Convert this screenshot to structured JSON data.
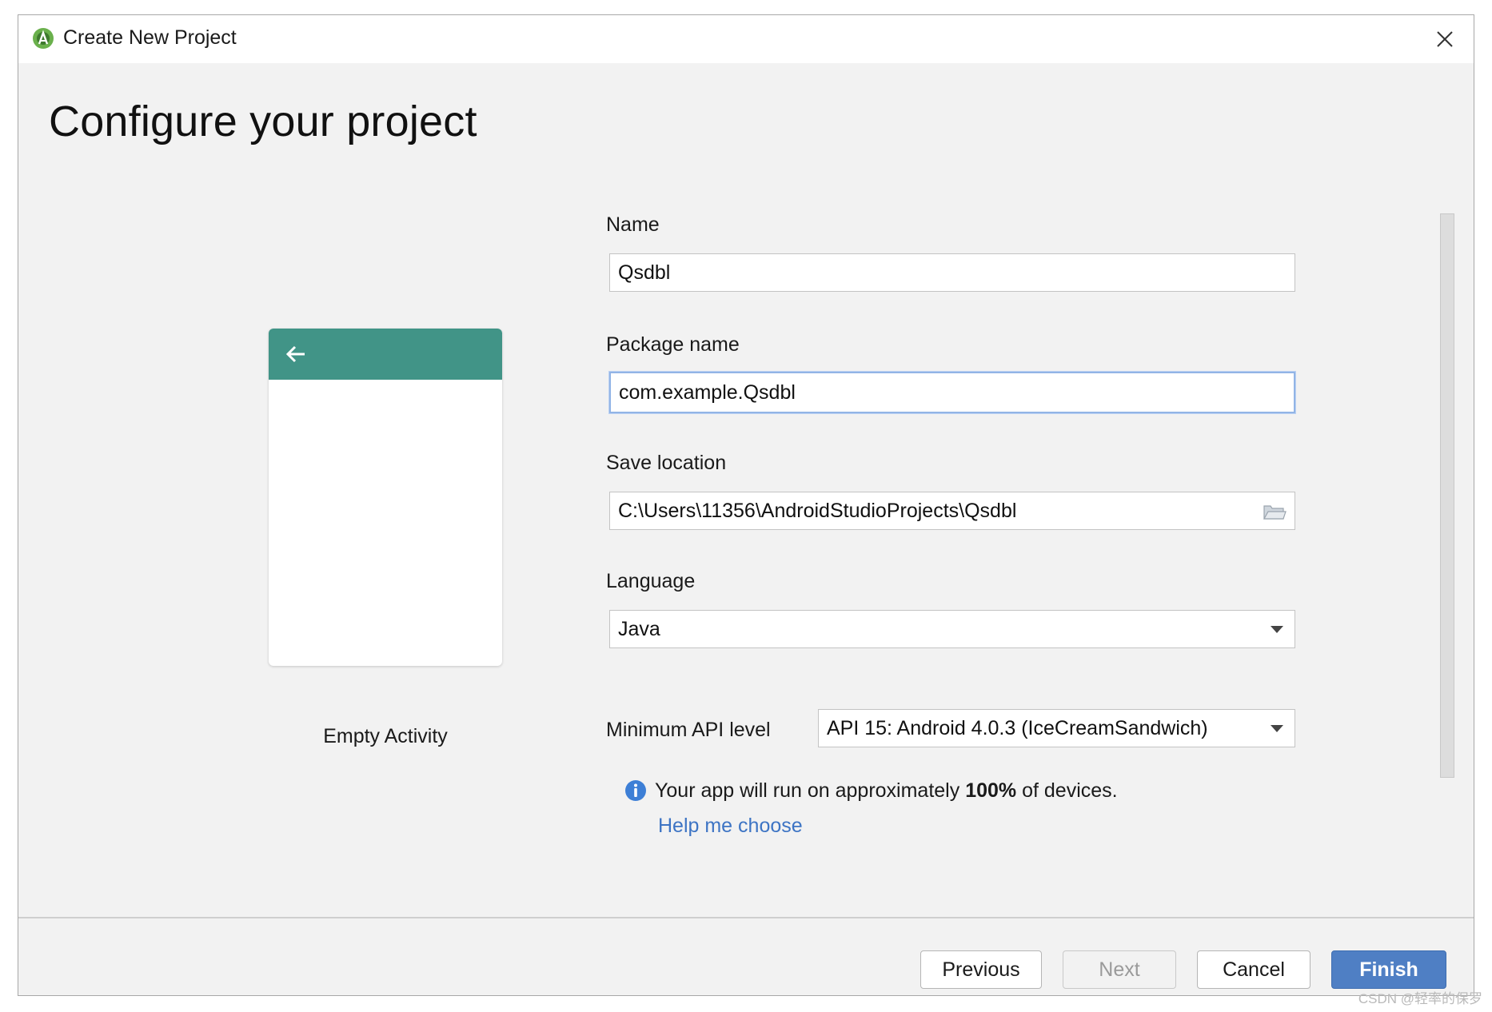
{
  "window": {
    "title": "Create New Project"
  },
  "page": {
    "heading": "Configure your project"
  },
  "preview": {
    "caption": "Empty Activity",
    "appbar_color": "#419487"
  },
  "form": {
    "name_label": "Name",
    "name_value": "Qsdbl",
    "package_label": "Package name",
    "package_value": "com.example.Qsdbl",
    "location_label": "Save location",
    "location_value": "C:\\Users\\11356\\AndroidStudioProjects\\Qsdbl",
    "language_label": "Language",
    "language_value": "Java",
    "api_label": "Minimum API level",
    "api_value": "API 15: Android 4.0.3 (IceCreamSandwich)"
  },
  "info": {
    "prefix": "Your app will run on approximately ",
    "percent": "100%",
    "suffix": " of devices.",
    "help_link": "Help me choose"
  },
  "buttons": {
    "previous": "Previous",
    "next": "Next",
    "cancel": "Cancel",
    "finish": "Finish"
  },
  "watermark": "CSDN @轻率的保罗",
  "colors": {
    "accent": "#4f7fc4",
    "link": "#3d74c4",
    "focus_border": "#92b4e6"
  }
}
